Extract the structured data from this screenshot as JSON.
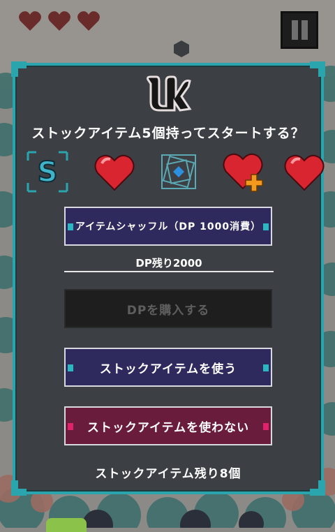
{
  "hud": {
    "lives": 3,
    "pause_icon": "pause-icon"
  },
  "dialog": {
    "logo_icon": "game-logo-icon",
    "question": "ストックアイテム5個持ってスタートする？",
    "items": [
      {
        "name": "shuffle-s-item-icon"
      },
      {
        "name": "heart-item-icon"
      },
      {
        "name": "blue-gem-frame-item-icon"
      },
      {
        "name": "heart-plus-item-icon"
      },
      {
        "name": "heart-item-icon"
      }
    ],
    "shuffle_button_label": "アイテムシャッフル（DP 1000消費）",
    "dp_remaining": "DP残り2000",
    "buy_dp_button_label": "DPを購入する",
    "use_stock_button_label": "ストックアイテムを使う",
    "no_use_stock_button_label": "ストックアイテムを使わない",
    "stock_remaining": "ストックアイテム残り8個"
  },
  "colors": {
    "accent_teal": "#2ba5ad",
    "button_navy": "#2e2a5e",
    "button_crimson": "#6a1c3d",
    "tab_pink": "#e0226a"
  }
}
